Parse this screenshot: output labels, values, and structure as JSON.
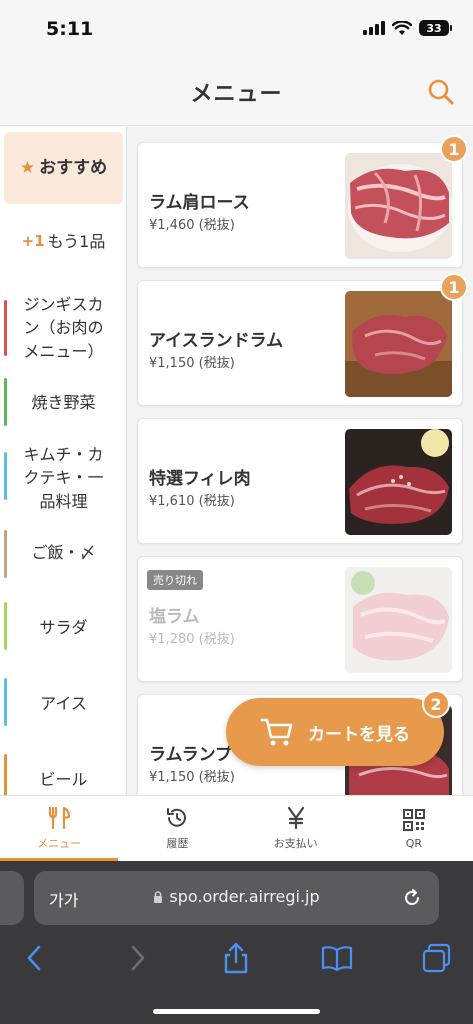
{
  "status": {
    "time": "5:11",
    "battery": "33"
  },
  "header": {
    "title": "メニュー",
    "search_icon": "search-icon"
  },
  "sidebar": {
    "recommended": "おすすめ",
    "plus_prefix": "+1",
    "plus_label": "もう1品",
    "items": [
      {
        "label": "ジンギスカン（お肉のメニュー）",
        "lines": [
          "ジンギスカ",
          "ン（お肉の",
          "メニュー）"
        ],
        "color": "#d9534f"
      },
      {
        "label": "焼き野菜",
        "lines": [
          "焼き野菜"
        ],
        "color": "#5cb85c"
      },
      {
        "label": "キムチ・カクテキ・一品料理",
        "lines": [
          "キムチ・カ",
          "クテキ・一",
          "品料理"
        ],
        "color": "#5bc0de"
      },
      {
        "label": "ご飯・〆",
        "lines": [
          "ご飯・〆"
        ],
        "color": "#c8a27a"
      },
      {
        "label": "サラダ",
        "lines": [
          "サラダ"
        ],
        "color": "#a4d65e"
      },
      {
        "label": "アイス",
        "lines": [
          "アイス"
        ],
        "color": "#5bc0de"
      },
      {
        "label": "ビール",
        "lines": [
          "ビール"
        ],
        "color": "#e8913d"
      }
    ]
  },
  "menu": [
    {
      "name": "ラム肩ロース",
      "price": "¥1,460 (税抜)",
      "count": "1",
      "sold_out": false
    },
    {
      "name": "アイスランドラム",
      "price": "¥1,150 (税抜)",
      "count": "1",
      "sold_out": false
    },
    {
      "name": "特選フィレ肉",
      "price": "¥1,610 (税抜)",
      "count": "",
      "sold_out": false
    },
    {
      "name": "塩ラム",
      "price": "¥1,280 (税抜)",
      "count": "",
      "sold_out": true,
      "sold_label": "売り切れ"
    },
    {
      "name": "ラムランプ",
      "price": "¥1,150 (税抜)",
      "count": "",
      "sold_out": false
    }
  ],
  "cart": {
    "label": "カートを見る",
    "count": "2"
  },
  "tabs": [
    {
      "label": "メニュー",
      "icon": "fork-knife-icon",
      "active": true
    },
    {
      "label": "履歴",
      "icon": "history-icon",
      "active": false
    },
    {
      "label": "お支払い",
      "icon": "yen-icon",
      "active": false
    },
    {
      "label": "QR",
      "icon": "qr-code-icon",
      "active": false
    }
  ],
  "browser": {
    "aa": "가가",
    "url": "spo.order.airregi.jp"
  },
  "colors": {
    "accent": "#e8913d",
    "recommended_bg": "#fbeadb"
  }
}
